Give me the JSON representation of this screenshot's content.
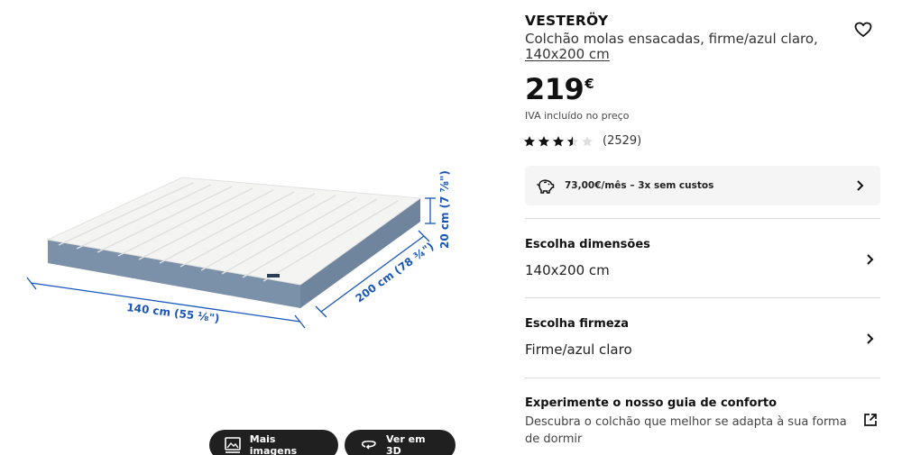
{
  "product": {
    "brand": "VESTERÖY",
    "description": "Colchão molas ensacadas, firme/azul claro,",
    "size_link": "140x200 cm",
    "price_number": "219",
    "price_currency": "€",
    "vat_note": "IVA incluído no preço",
    "rating_value": 3.5,
    "rating_max": 5,
    "rating_count": "(2529)"
  },
  "finance": {
    "text": "73,00€/mês – 3x sem custos"
  },
  "options": {
    "dimensions_title": "Escolha dimensões",
    "dimensions_value": "140x200 cm",
    "firmness_title": "Escolha firmeza",
    "firmness_value": "Firme/azul claro"
  },
  "guide": {
    "title": "Experimente o nosso guia de conforto",
    "description": "Descubra o colchão que melhor se adapta à sua forma de dormir"
  },
  "image": {
    "width_label": "140 cm (55 ⅛\")",
    "length_label": "200 cm (78 ¾\")",
    "height_label": "20 cm (7 ⅞\")"
  },
  "buttons": {
    "more_images": "Mais imagens",
    "view_3d": "Ver em 3D"
  },
  "icons": {
    "favourite": "heart-icon",
    "finance": "piggy-bank-icon",
    "chevron": "chevron-right-icon",
    "external": "external-link-icon",
    "gallery": "gallery-icon",
    "rotate_3d": "rotate-3d-icon"
  },
  "colors": {
    "dimension_blue": "#1a56b8",
    "mattress_side": "#7f94ad",
    "button_dark": "#202020",
    "finance_bg": "#f5f5f5"
  }
}
